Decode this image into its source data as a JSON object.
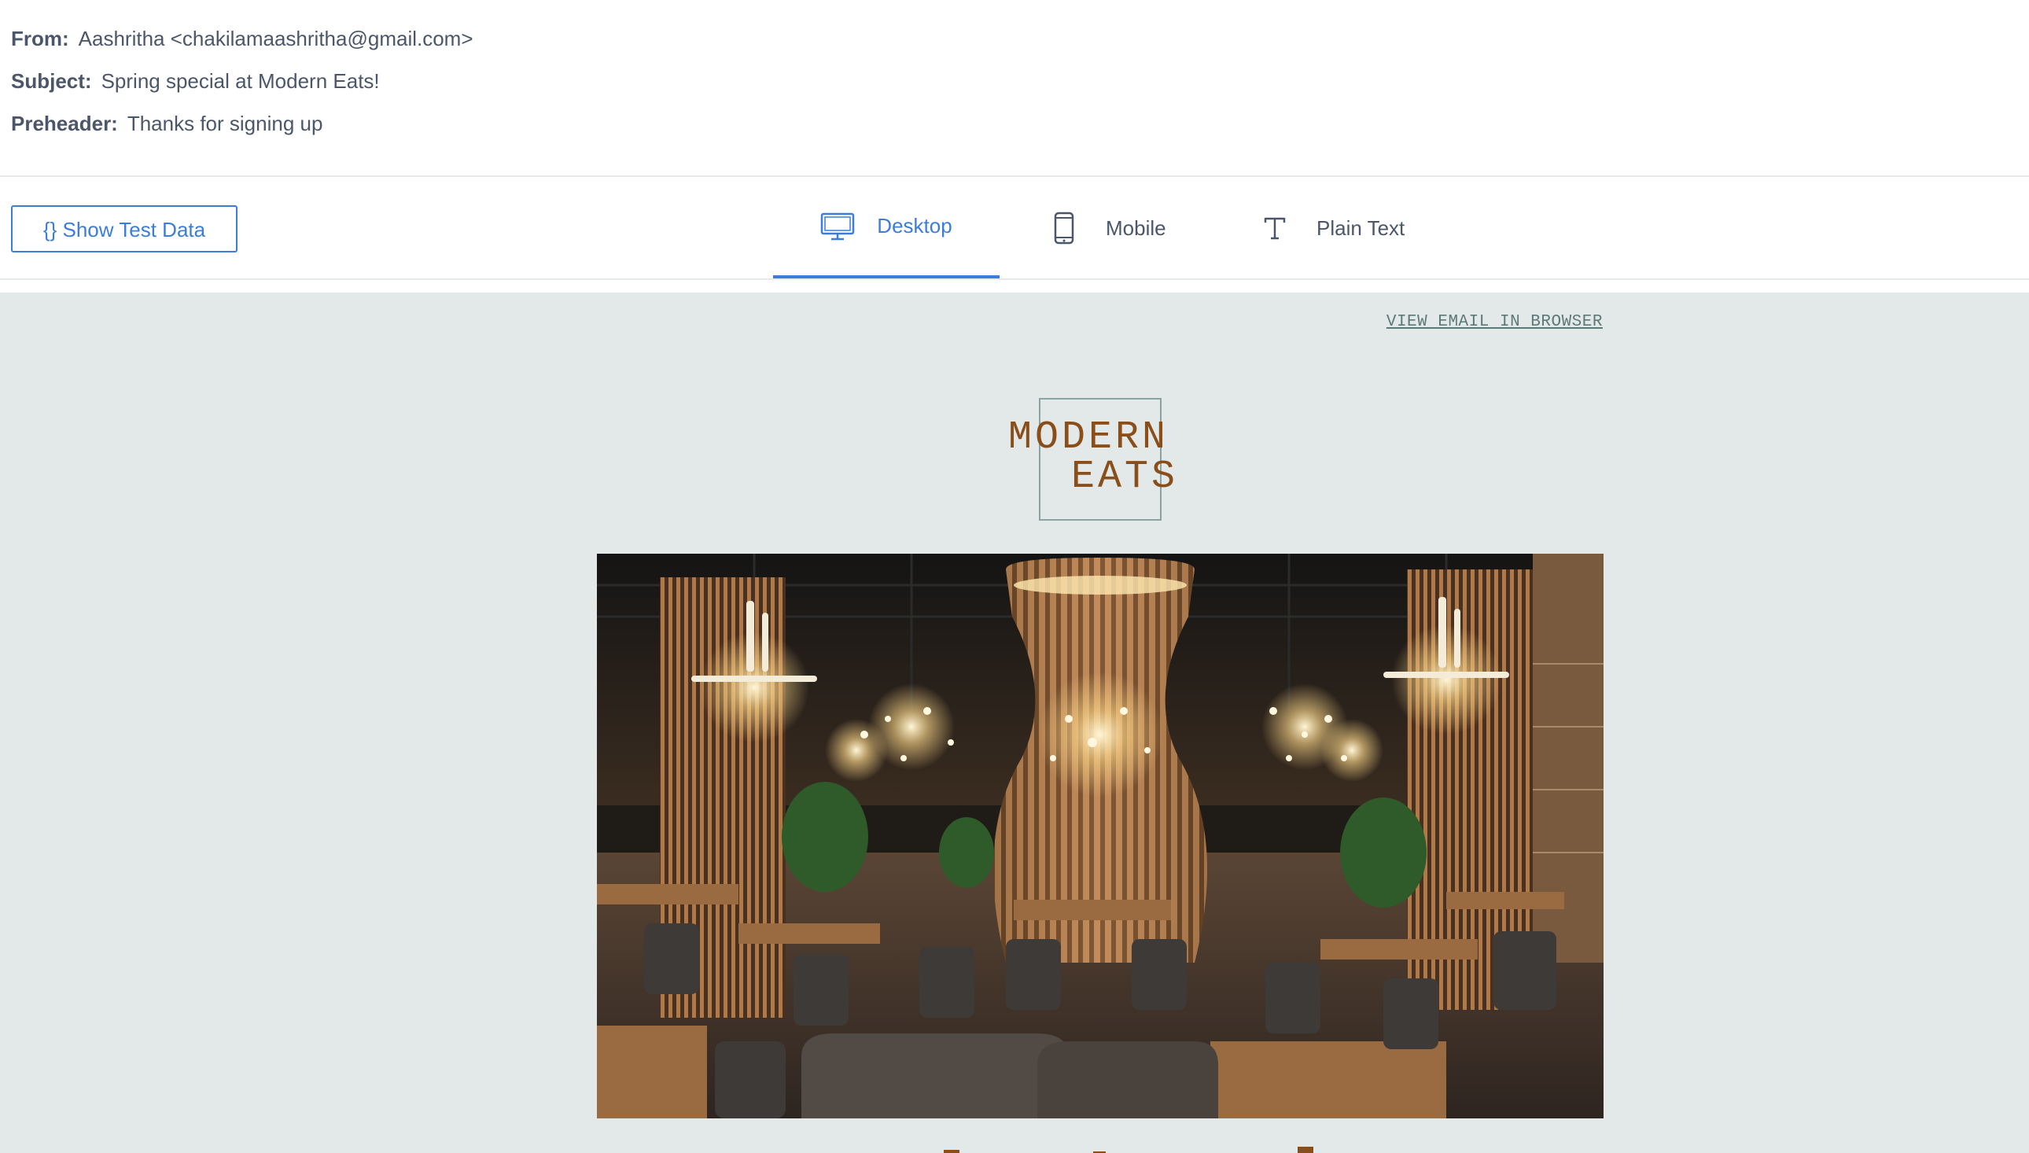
{
  "email": {
    "from_label": "From:",
    "from_value": "Aashritha <chakilamaashritha@gmail.com>",
    "subject_label": "Subject:",
    "subject_value": "Spring special at Modern Eats!",
    "preheader_label": "Preheader:",
    "preheader_value": "Thanks for signing up"
  },
  "toolbar": {
    "test_data_button": "{} Show Test Data",
    "tabs": [
      {
        "label": "Desktop",
        "icon": "desktop-monitor-icon",
        "active": true
      },
      {
        "label": "Mobile",
        "icon": "mobile-phone-icon",
        "active": false
      },
      {
        "label": "Plain Text",
        "icon": "text-t-icon",
        "active": false
      }
    ]
  },
  "preview": {
    "view_in_browser": "VIEW EMAIL IN BROWSER",
    "logo": {
      "line1": "MODERN",
      "line2": "EATS"
    },
    "hero_image": "restaurant-interior-photo"
  },
  "colors": {
    "accent": "#3b7dd8",
    "preview_bg": "#e3e9e8",
    "logo_brown": "#8a4e1b",
    "logo_border": "#8aa3a0",
    "link_gray": "#5d7a78"
  }
}
